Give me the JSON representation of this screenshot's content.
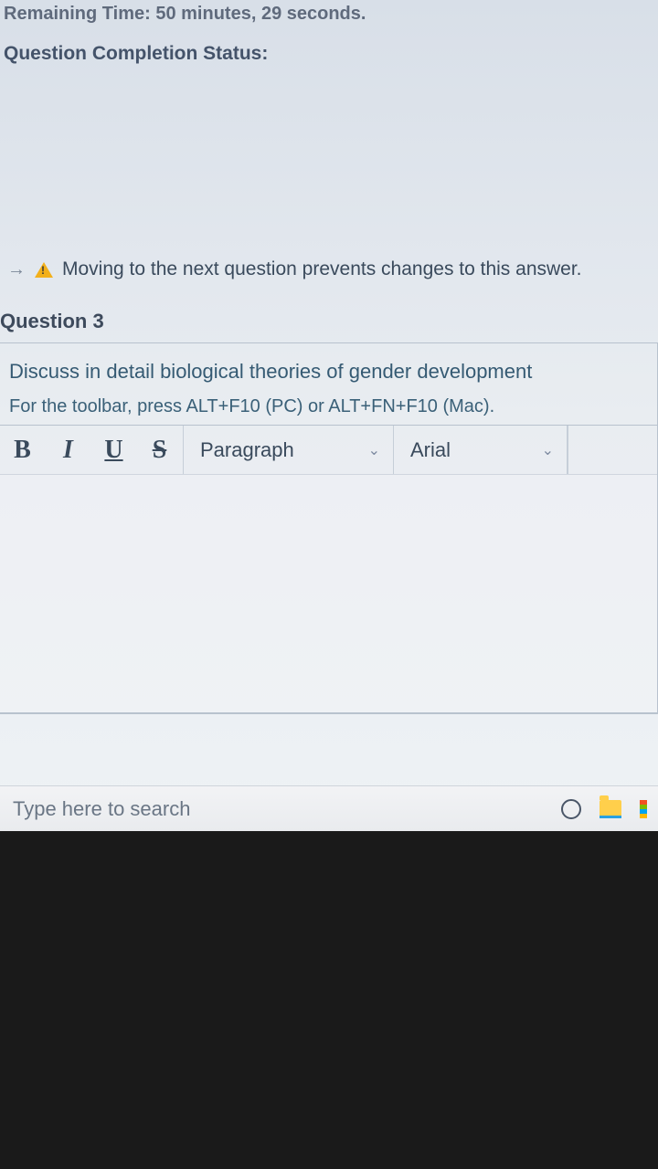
{
  "header": {
    "remaining_label": "Remaining Time:",
    "remaining_value": "50 minutes, 29 seconds.",
    "completion_label": "Question Completion Status:"
  },
  "warning": {
    "text": "Moving to the next question prevents changes to this answer."
  },
  "question": {
    "label": "Question 3",
    "prompt": "Discuss in detail biological theories of gender development",
    "toolbar_hint": "For the toolbar, press ALT+F10 (PC) or ALT+FN+F10 (Mac)."
  },
  "editor": {
    "bold": "B",
    "italic": "I",
    "underline": "U",
    "strike": "S",
    "block_format": "Paragraph",
    "font_family": "Arial"
  },
  "taskbar": {
    "search_placeholder": "Type here to search"
  }
}
